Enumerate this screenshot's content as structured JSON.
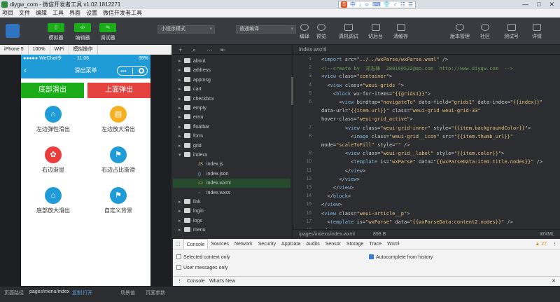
{
  "window": {
    "title": "diygw_com - 微信开发者工具 v1.02.1812271"
  },
  "ime": {
    "items": [
      "中",
      "↓",
      "☺",
      "⌨",
      "👕",
      "♂",
      "☷",
      "☰"
    ]
  },
  "menubar": [
    "项目",
    "文件",
    "编辑",
    "工具",
    "界面",
    "设置",
    "微信开发者工具"
  ],
  "toolbar": {
    "left_buttons": [
      {
        "icon": "▯",
        "label": "模拟器"
      },
      {
        "icon": "‹/›",
        "label": "编辑器"
      },
      {
        "icon": "≒",
        "label": "调试器"
      }
    ],
    "mode_select": "小程序模式",
    "compile_select": "普通编译",
    "actions": [
      "编译",
      "预览",
      "真机调试",
      "切后台",
      "清缓存"
    ],
    "right_actions": [
      "版本管理",
      "社区",
      "测试号",
      "详情"
    ]
  },
  "device_bar": {
    "device": "iPhone 5",
    "zoom": "100%",
    "network": "WiFi",
    "operate": "模拟操作"
  },
  "phone": {
    "status": "●●●●● WeChat令",
    "time": "11:06",
    "battery": "99%",
    "nav_title": "滑出菜单",
    "btn_left": "底部滑出",
    "btn_right": "上面弹出",
    "grid": [
      {
        "label": "左边弹性滑出",
        "icon": "⌂",
        "color": "#1f9bd8"
      },
      {
        "label": "左边放大滑出",
        "icon": "▤",
        "color": "#f6b01d"
      },
      {
        "label": "右边渐显",
        "icon": "✿",
        "color": "#ec3d3d"
      },
      {
        "label": "右边占比渐滑",
        "icon": "⚑",
        "color": "#1f9bd8"
      },
      {
        "label": "底部放大滑出",
        "icon": "⌂",
        "color": "#1f9bd8"
      },
      {
        "label": "自定义背景",
        "icon": "⚑",
        "color": "#1f9bd8"
      }
    ]
  },
  "filetree": {
    "items": [
      "about",
      "address",
      "appmsg",
      "cart",
      "checkbox",
      "empty",
      "error",
      "floatbar",
      "form",
      "grid",
      "indexx",
      "index.js",
      "index.json",
      "index.wxml",
      "index.wxss",
      "link",
      "login",
      "logs",
      "menu"
    ]
  },
  "editor": {
    "tab": "index.wxml",
    "line_numbers": [
      "1",
      "2",
      "3",
      "4",
      "5",
      "6",
      "",
      "",
      "7",
      "8",
      "",
      "9",
      "10",
      "11",
      "12",
      "13",
      "14",
      "15",
      "16",
      "17",
      "18"
    ],
    "lines": [
      "<import src=\"../../wxParse/wxParse.wxml\" />",
      "<!--create by  邓志锋  280160522@qq.com  http://www.diygw.com  -->",
      "<view class=\"container\">",
      "  <view class=\"weui-grids \">",
      "    <block wx:for-items=\"{{grids1}}\">",
      "      <view bindtap=\"navigateTo\" data-field=\"grids1\" data-index=\"{{index}}\"",
      "data-url=\"{{item.url}}\" class=\"weui-grid weui-grid-33\"",
      "hover-class=\"weui-grid_active\">",
      "        <view class=\"weui-grid-inner\" style=\"{{item.backgroundColor}}\">",
      "          <image class=\"weui-grid__icon\" src=\"{{item.thumb_url}}\"",
      "mode=\"scaleToFill\" style=\"\" />",
      "        <view class=\"weui-grid__label\" style=\"{{item.color}}\">",
      "          <template is=\"wxParse\" data=\"{{wxParseData:item.title.nodes}}\" />",
      "        </view>",
      "      </view>",
      "    </view>",
      "  </block>",
      "</view>",
      "<view class=\"weui-article__p\">",
      "  <template is=\"wxParse\" data=\"{{wxParseData:content2.nodes}}\" />",
      "</view>"
    ],
    "status_path": "/pages/indexx/index.wxml",
    "status_size": "898 B",
    "status_lang": "WXML"
  },
  "devtools": {
    "tabs": [
      "Console",
      "Sources",
      "Network",
      "Security",
      "AppData",
      "Audits",
      "Sensor",
      "Storage",
      "Trace",
      "Wxml"
    ],
    "warnings": "▲ 27",
    "filter1": "Selected context only",
    "filter2": "User messages only",
    "filter3": "Autocomplete from history",
    "drawer_tabs": [
      "Console",
      "What's New"
    ]
  },
  "bottom": {
    "path_label": "页面路径",
    "path": "pages/menu/index",
    "copy": "复制",
    "open": "打开",
    "scene": "场景值",
    "params": "页面参数"
  }
}
